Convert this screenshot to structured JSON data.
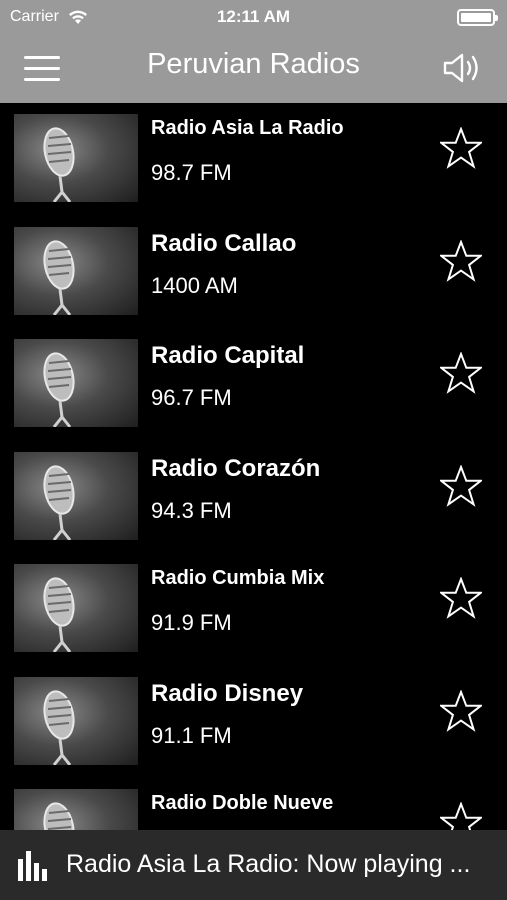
{
  "status": {
    "carrier": "Carrier",
    "time": "12:11 AM"
  },
  "nav": {
    "title": "Peruvian Radios",
    "menu_icon": "hamburger-menu-icon",
    "volume_icon": "speaker-volume-icon"
  },
  "stations": [
    {
      "name": "Radio Asia La Radio",
      "frequency": "98.7 FM"
    },
    {
      "name": "Radio Callao",
      "frequency": "1400 AM"
    },
    {
      "name": "Radio Capital",
      "frequency": "96.7 FM"
    },
    {
      "name": "Radio Corazón",
      "frequency": "94.3 FM"
    },
    {
      "name": "Radio Cumbia Mix",
      "frequency": "91.9 FM"
    },
    {
      "name": "Radio Disney",
      "frequency": "91.1 FM"
    },
    {
      "name": "Radio Doble Nueve",
      "frequency": ""
    }
  ],
  "now_playing": {
    "text": "Radio Asia La Radio: Now playing ..."
  },
  "colors": {
    "header": "#9a9a9a",
    "background": "#000000",
    "now_bar": "#2a2a2a"
  }
}
